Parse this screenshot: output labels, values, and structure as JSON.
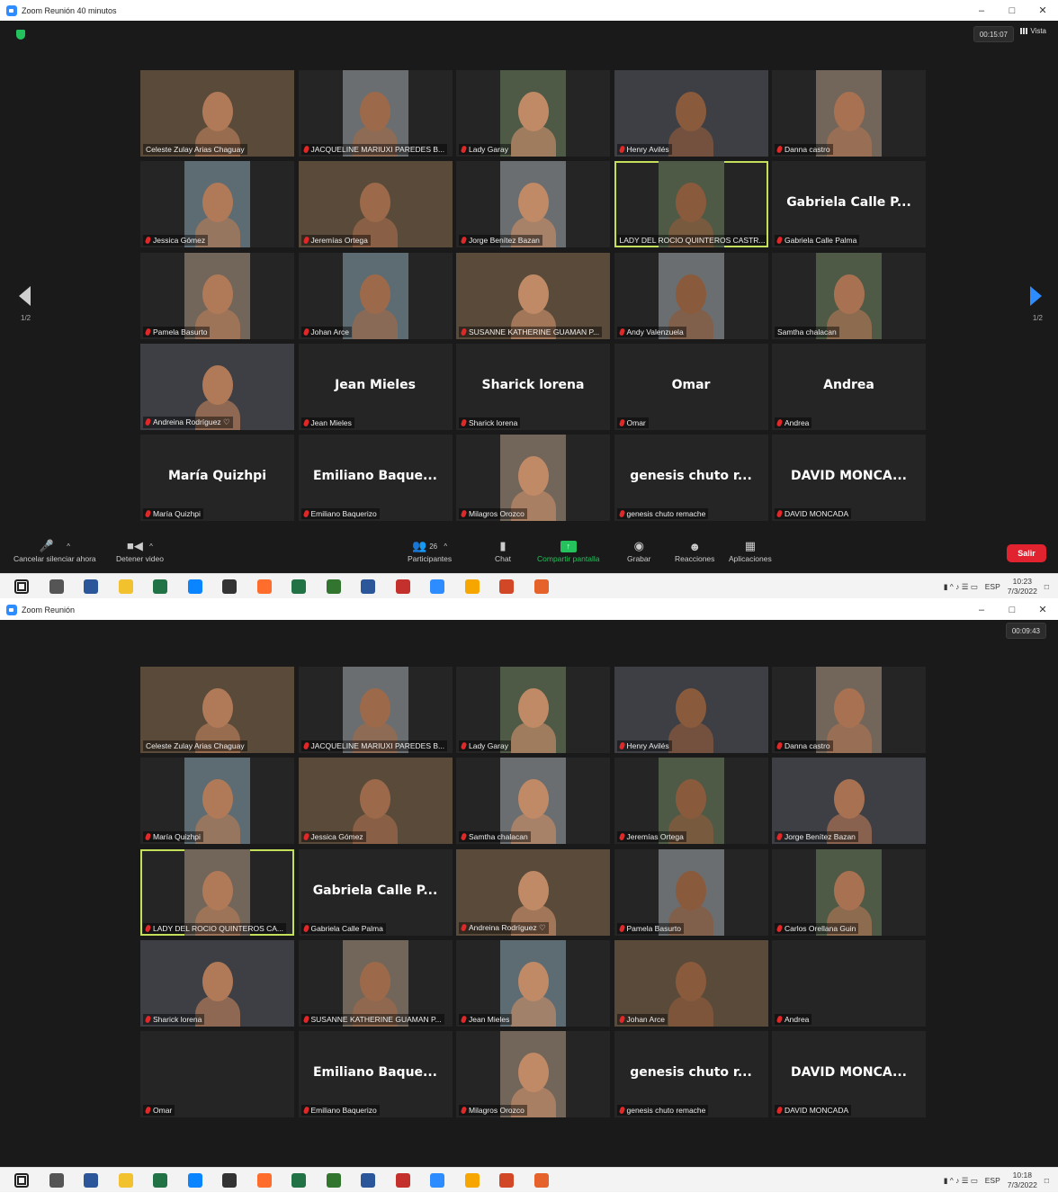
{
  "top": {
    "title": "Zoom Reunión 40 minutos",
    "timer": "00:15:07",
    "view_label": "Vista",
    "page_indicator": "1/2",
    "tiles": [
      {
        "name": "Celeste Zulay Arias Chaguay",
        "video": true,
        "muted": false
      },
      {
        "name": "JACQUELINE MARIUXI PAREDES B...",
        "video": true,
        "muted": true
      },
      {
        "name": "Lady Garay",
        "video": true,
        "muted": true
      },
      {
        "name": "Henry Avilés",
        "video": true,
        "muted": true
      },
      {
        "name": "Danna castro",
        "video": true,
        "muted": true
      },
      {
        "name": "Jessica Gómez",
        "video": true,
        "muted": true
      },
      {
        "name": "Jeremías Ortega",
        "video": true,
        "muted": true
      },
      {
        "name": "Jorge Benítez Bazan",
        "video": true,
        "muted": true
      },
      {
        "name": "LADY DEL ROCIO QUINTEROS CASTR...",
        "video": true,
        "muted": false,
        "active": true
      },
      {
        "name": "Gabriela Calle Palma",
        "big": "Gabriela Calle P...",
        "video": false,
        "muted": true
      },
      {
        "name": "Pamela Basurto",
        "video": true,
        "muted": true
      },
      {
        "name": "Johan Arce",
        "video": true,
        "muted": true
      },
      {
        "name": "SUSANNE KATHERINE GUAMAN P...",
        "video": true,
        "muted": true
      },
      {
        "name": "Andy Valenzuela",
        "video": true,
        "muted": true
      },
      {
        "name": "Samtha chalacan",
        "video": true,
        "muted": false
      },
      {
        "name": "Andreina Rodríguez ♡",
        "video": true,
        "muted": true
      },
      {
        "name": "Jean Mieles",
        "big": "Jean Mieles",
        "video": false,
        "muted": true
      },
      {
        "name": "Sharick lorena",
        "big": "Sharick lorena",
        "video": false,
        "muted": true
      },
      {
        "name": "Omar",
        "big": "Omar",
        "video": false,
        "muted": true
      },
      {
        "name": "Andrea",
        "big": "Andrea",
        "video": false,
        "muted": true
      },
      {
        "name": "María Quizhpi",
        "big": "María Quizhpi",
        "video": false,
        "muted": true
      },
      {
        "name": "Emiliano Baquerizo",
        "big": "Emiliano Baque...",
        "video": false,
        "muted": true
      },
      {
        "name": "Milagros Orozco",
        "video": true,
        "muted": true
      },
      {
        "name": "genesis chuto remache",
        "big": "genesis chuto r...",
        "video": false,
        "muted": true
      },
      {
        "name": "DAVID MONCADA",
        "big": "DAVID MONCA...",
        "video": false,
        "muted": true
      }
    ],
    "toolbar": {
      "unmute": "Cancelar silenciar ahora",
      "video": "Detener video",
      "participants": "Participantes",
      "participants_count": "26",
      "chat": "Chat",
      "share": "Compartir pantalla",
      "record": "Grabar",
      "reactions": "Reacciones",
      "apps": "Aplicaciones",
      "exit": "Salir"
    },
    "taskbar": {
      "lang": "ESP",
      "time": "10:23",
      "date": "7/3/2022"
    }
  },
  "bottom": {
    "title": "Zoom Reunión",
    "timer": "00:09:43",
    "tiles": [
      {
        "name": "Celeste Zulay Arias Chaguay",
        "video": true,
        "muted": false
      },
      {
        "name": "JACQUELINE MARIUXI PAREDES B...",
        "video": true,
        "muted": true
      },
      {
        "name": "Lady Garay",
        "video": true,
        "muted": true
      },
      {
        "name": "Henry Avilés",
        "video": true,
        "muted": true
      },
      {
        "name": "Danna castro",
        "video": true,
        "muted": true
      },
      {
        "name": "María Quizhpi",
        "video": true,
        "muted": true
      },
      {
        "name": "Jessica Gómez",
        "video": true,
        "muted": true
      },
      {
        "name": "Samtha chalacan",
        "video": true,
        "muted": true
      },
      {
        "name": "Jeremías Ortega",
        "video": true,
        "muted": true
      },
      {
        "name": "Jorge Benítez Bazan",
        "video": true,
        "muted": true
      },
      {
        "name": "LADY DEL ROCIO QUINTEROS CA...",
        "video": true,
        "muted": true,
        "active": true
      },
      {
        "name": "Gabriela Calle Palma",
        "big": "Gabriela Calle P...",
        "video": false,
        "muted": true
      },
      {
        "name": "Andreina Rodríguez ♡",
        "video": true,
        "muted": true
      },
      {
        "name": "Pamela Basurto",
        "video": true,
        "muted": true
      },
      {
        "name": "Carlos Orellana Guin",
        "video": true,
        "muted": true
      },
      {
        "name": "Sharick lorena",
        "video": true,
        "muted": true
      },
      {
        "name": "SUSANNE KATHERINE GUAMAN P...",
        "video": true,
        "muted": true
      },
      {
        "name": "Jean Mieles",
        "video": true,
        "muted": true
      },
      {
        "name": "Johan Arce",
        "video": true,
        "muted": true
      },
      {
        "name": "Andrea",
        "video": false,
        "muted": true
      },
      {
        "name": "Omar",
        "video": false,
        "muted": true
      },
      {
        "name": "Emiliano Baquerizo",
        "big": "Emiliano Baque...",
        "video": false,
        "muted": true
      },
      {
        "name": "Milagros Orozco",
        "video": true,
        "muted": true
      },
      {
        "name": "genesis chuto remache",
        "big": "genesis chuto r...",
        "video": false,
        "muted": true
      },
      {
        "name": "DAVID MONCADA",
        "big": "DAVID MONCA...",
        "video": false,
        "muted": true
      }
    ],
    "taskbar": {
      "lang": "ESP",
      "time": "10:18",
      "date": "7/3/2022"
    }
  },
  "colors": {
    "accent": "#2d8cff",
    "active_border": "#c4e05a",
    "exit": "#e0232f",
    "share": "#25c15c",
    "muted": "#e02828"
  },
  "icons": [
    "shield-icon",
    "grid-icon",
    "mic-muted-icon",
    "camera-icon",
    "participants-icon",
    "chat-icon",
    "share-screen-icon",
    "record-icon",
    "reactions-icon",
    "apps-icon",
    "windows-start-icon"
  ]
}
